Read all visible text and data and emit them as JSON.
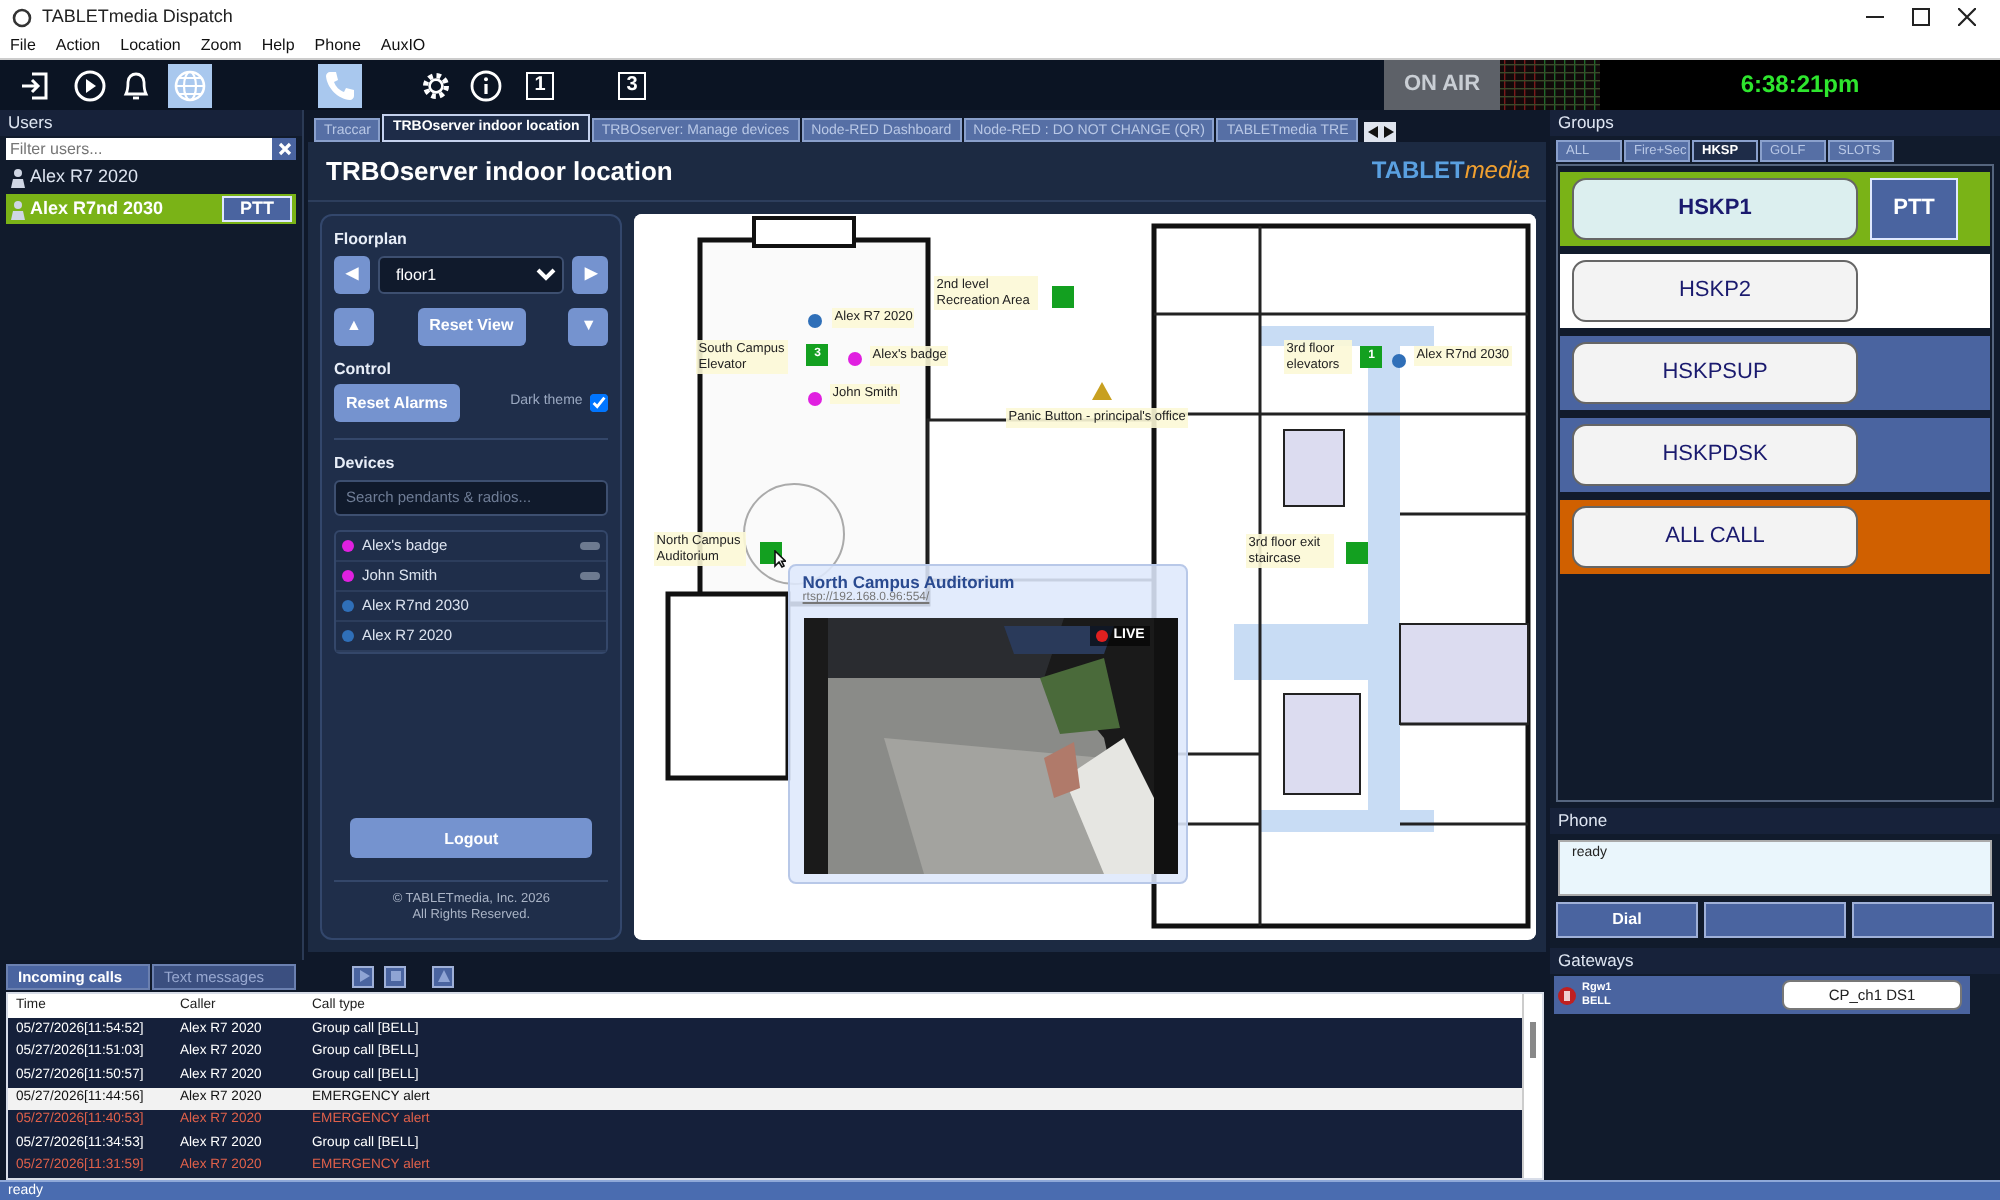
{
  "window": {
    "title": "TABLETmedia Dispatch"
  },
  "menu": [
    "File",
    "Action",
    "Location",
    "Zoom",
    "Help",
    "Phone",
    "AuxIO"
  ],
  "toolbar": {
    "buttons": [
      {
        "kind": "login",
        "selected": false
      },
      {
        "kind": "play",
        "selected": false
      },
      {
        "kind": "bell",
        "selected": false
      },
      {
        "kind": "globe",
        "selected": true
      },
      {
        "kind": "phone",
        "selected": true
      },
      {
        "kind": "gear",
        "selected": false
      },
      {
        "kind": "info",
        "selected": false
      },
      {
        "kind": "number",
        "label": "1",
        "selected": false
      },
      {
        "kind": "number",
        "label": "3",
        "selected": false
      }
    ],
    "on_air": "ON AIR",
    "clock": "6:38:21pm"
  },
  "users": {
    "title": "Users",
    "filter_placeholder": "Filter users...",
    "items": [
      {
        "name": "Alex R7 2020",
        "selected": false
      },
      {
        "name": "Alex R7nd 2030",
        "selected": true,
        "ptt": "PTT"
      }
    ]
  },
  "browser_tabs": [
    {
      "label": "Traccar",
      "selected": false
    },
    {
      "label": "TRBOserver indoor location",
      "selected": true
    },
    {
      "label": "TRBOserver: Manage devices",
      "selected": false
    },
    {
      "label": "Node-RED Dashboard",
      "selected": false
    },
    {
      "label": "Node-RED : DO NOT CHANGE (QR)",
      "selected": false
    },
    {
      "label": "TABLETmedia TRE",
      "selected": false
    }
  ],
  "page": {
    "title": "TRBOserver indoor location",
    "logo": {
      "brand": "TABLET",
      "suffix": "media"
    },
    "floorplan": {
      "title": "Floorplan",
      "prev": "◀",
      "next": "▶",
      "up": "▲",
      "down": "▼",
      "floor": "floor1",
      "reset_view": "Reset View"
    },
    "control": {
      "title": "Control",
      "reset_alarms": "Reset Alarms",
      "dark_theme_label": "Dark theme",
      "dark_theme": true
    },
    "devices": {
      "title": "Devices",
      "placeholder": "Search pendants & radios...",
      "items": [
        {
          "name": "Alex's badge",
          "color": "#e020e0",
          "kind": "badge"
        },
        {
          "name": "John Smith",
          "color": "#e020e0",
          "kind": "badge"
        },
        {
          "name": "Alex R7nd 2030",
          "color": "#2f6fb8",
          "kind": "radio"
        },
        {
          "name": "Alex R7 2020",
          "color": "#2f6fb8",
          "kind": "radio"
        }
      ]
    },
    "logout": "Logout",
    "footer": [
      "© TABLETmedia, Inc. 2026",
      "All Rights Reserved."
    ]
  },
  "map": {
    "markers": [
      {
        "kind": "device",
        "label": "Alex R7 2020",
        "color": "#2f6fb8"
      },
      {
        "kind": "zone",
        "label": "2nd level Recreation Area"
      },
      {
        "kind": "zone",
        "label": "South Campus Elevator",
        "number": "3"
      },
      {
        "kind": "device",
        "label": "Alex's badge",
        "color": "#e020e0"
      },
      {
        "kind": "zone",
        "label": "3rd floor elevators",
        "number": "1"
      },
      {
        "kind": "device",
        "label": "Alex R7nd 2030",
        "color": "#2f6fb8"
      },
      {
        "kind": "device",
        "label": "John Smith",
        "color": "#e020e0"
      },
      {
        "kind": "alarm",
        "label": "Panic Button - principal's office"
      },
      {
        "kind": "zone",
        "label": "North Campus Auditorium"
      },
      {
        "kind": "zone",
        "label": "3rd floor exit staircase"
      }
    ],
    "camera": {
      "title": "North Campus Auditorium",
      "url": "rtsp://192.168.0.96:554/",
      "live": "LIVE"
    }
  },
  "groups": {
    "title": "Groups",
    "tabs": [
      {
        "label": "ALL",
        "selected": false
      },
      {
        "label": "Fire+Sec",
        "selected": false
      },
      {
        "label": "HKSP",
        "selected": true
      },
      {
        "label": "GOLF",
        "selected": false
      },
      {
        "label": "SLOTS",
        "selected": false
      }
    ],
    "items": [
      {
        "name": "HSKP1",
        "color": "#7ab317",
        "selected": true,
        "ptt": "PTT"
      },
      {
        "name": "HSKP2",
        "color": "#ffffff",
        "selected": false
      },
      {
        "name": "HSKPSUP",
        "color": "#4a64a0",
        "selected": false
      },
      {
        "name": "HSKPDSK",
        "color": "#4a64a0",
        "selected": false
      },
      {
        "name": "ALL CALL",
        "color": "#d06000",
        "selected": false
      }
    ]
  },
  "phone": {
    "title": "Phone",
    "status": "ready",
    "dial": "Dial"
  },
  "gateways": {
    "title": "Gateways",
    "items": [
      {
        "name": "Rgw1",
        "sub": "BELL",
        "channel": "CP_ch1 DS1"
      }
    ]
  },
  "calls": {
    "tabs": [
      {
        "label": "Incoming calls",
        "selected": true
      },
      {
        "label": "Text messages",
        "selected": false
      }
    ],
    "columns": [
      "Time",
      "Caller",
      "Call type"
    ],
    "rows": [
      {
        "time": "05/27/2026[11:54:52]",
        "caller": "Alex R7 2020",
        "type": "Group call [BELL]",
        "selected": false,
        "alert": false
      },
      {
        "time": "05/27/2026[11:51:03]",
        "caller": "Alex R7 2020",
        "type": "Group call [BELL]",
        "selected": false,
        "alert": false
      },
      {
        "time": "05/27/2026[11:50:57]",
        "caller": "Alex R7 2020",
        "type": "Group call [BELL]",
        "selected": false,
        "alert": false
      },
      {
        "time": "05/27/2026[11:44:56]",
        "caller": "Alex R7 2020",
        "type": "EMERGENCY alert",
        "selected": true,
        "alert": false
      },
      {
        "time": "05/27/2026[11:40:53]",
        "caller": "Alex R7 2020",
        "type": "EMERGENCY alert",
        "selected": false,
        "alert": true
      },
      {
        "time": "05/27/2026[11:34:53]",
        "caller": "Alex R7 2020",
        "type": "Group call [BELL]",
        "selected": false,
        "alert": false
      },
      {
        "time": "05/27/2026[11:31:59]",
        "caller": "Alex R7 2020",
        "type": "EMERGENCY alert",
        "selected": false,
        "alert": true
      }
    ]
  },
  "status_bar": "ready"
}
